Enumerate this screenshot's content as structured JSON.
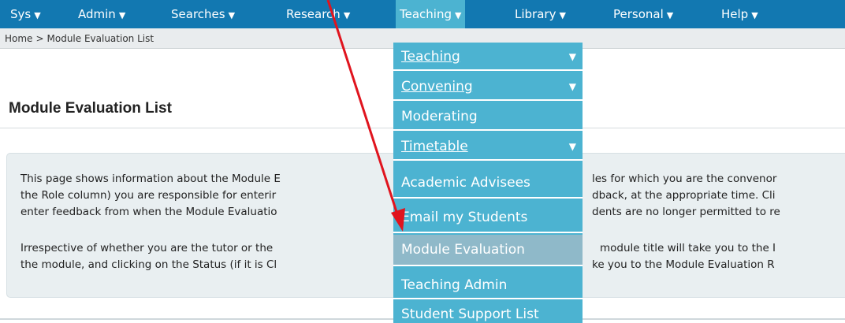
{
  "topnav": {
    "items": [
      {
        "label": "Sys",
        "caret": "▼"
      },
      {
        "label": "Admin",
        "caret": "▼"
      },
      {
        "label": "Searches",
        "caret": "▼"
      },
      {
        "label": "Research",
        "caret": "▼"
      },
      {
        "label": "Teaching",
        "caret": "▼"
      },
      {
        "label": "Library",
        "caret": "▼"
      },
      {
        "label": "Personal",
        "caret": "▼"
      },
      {
        "label": "Help",
        "caret": "▼"
      }
    ],
    "active_item": "Teaching"
  },
  "breadcrumb": {
    "home": "Home",
    "separator": ">",
    "current": "Module Evaluation List"
  },
  "page": {
    "title": "Module Evaluation List"
  },
  "info": {
    "paragraph1": [
      "This page shows information about the Module E",
      "the Role column) you are responsible for enterir",
      "enter feedback from when the Module Evaluatio"
    ],
    "paragraph2": [
      "Irrespective of whether you are the tutor or the",
      "the module, and clicking on the Status (if it is Cl"
    ],
    "tail1": [
      "les for which you are the convenor",
      "dback, at the appropriate time. Cli",
      "dents are no longer permitted to re"
    ],
    "tail2": [
      "module title will take you to the I",
      "ke you to the Module Evaluation R"
    ]
  },
  "dropdown": {
    "items": [
      {
        "label": "Teaching",
        "arrow": "▼"
      },
      {
        "label": "Convening",
        "arrow": "▼"
      },
      {
        "label": "Moderating",
        "arrow": ""
      },
      {
        "label": "Timetable",
        "arrow": "▼"
      },
      {
        "label": "Academic Advisees",
        "arrow": ""
      },
      {
        "label": "Email my Students",
        "arrow": ""
      },
      {
        "label": "Module Evaluation",
        "arrow": ""
      },
      {
        "label": "Teaching Admin",
        "arrow": ""
      },
      {
        "label": "Student Support List",
        "arrow": ""
      }
    ],
    "highlighted_item": "Module Evaluation"
  },
  "colors": {
    "nav_background": "#1278b1",
    "nav_active": "#4cb3d1",
    "dropdown_background": "#4cb3d1",
    "dropdown_hover": "#8fb9c9",
    "annotation_arrow": "#e0141e"
  },
  "icons": {
    "caret": "chevron-down-icon",
    "annotation": "red-arrow-annotation"
  }
}
